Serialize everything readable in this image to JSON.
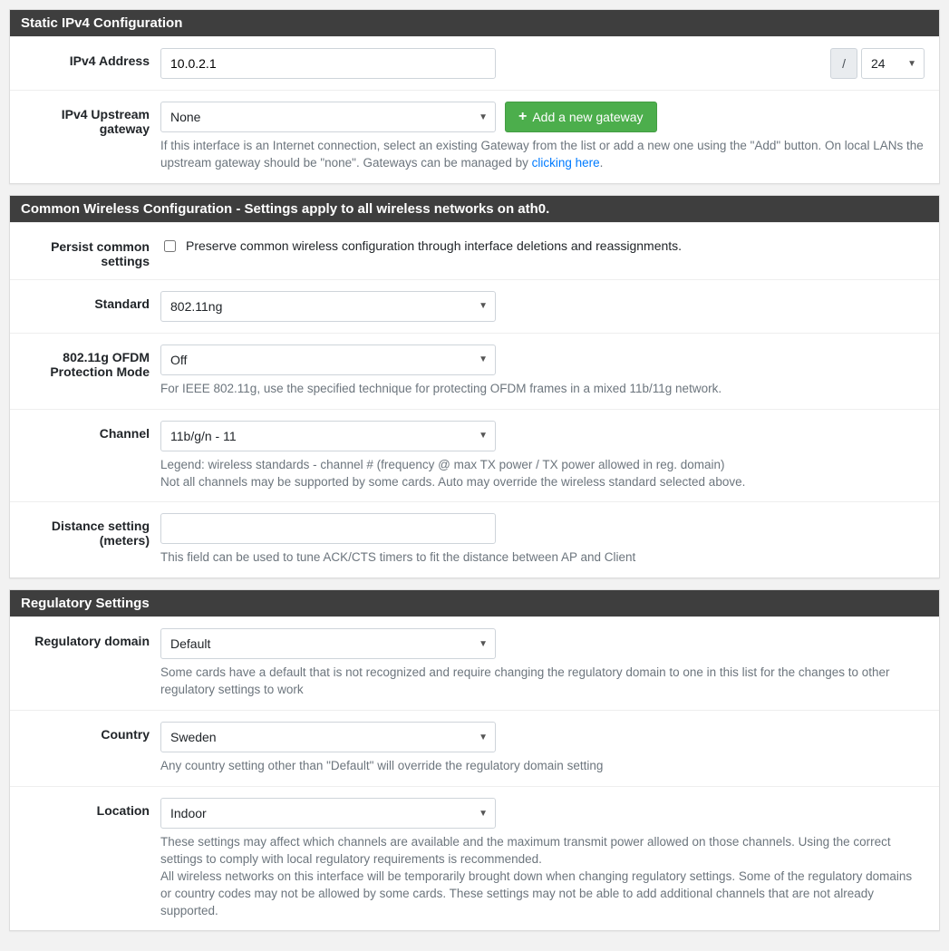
{
  "static_ipv4": {
    "title": "Static IPv4 Configuration",
    "address_label": "IPv4 Address",
    "address_value": "10.0.2.1",
    "slash": "/",
    "cidr": "24",
    "gateway_label": "IPv4 Upstream gateway",
    "gateway_value": "None",
    "add_gateway_btn": "Add a new gateway",
    "gateway_help_1": "If this interface is an Internet connection, select an existing Gateway from the list or add a new one using the \"Add\" button. On local LANs the upstream gateway should be \"none\". Gateways can be managed by ",
    "gateway_help_link": "clicking here",
    "gateway_help_2": "."
  },
  "common_wireless": {
    "title": "Common Wireless Configuration - Settings apply to all wireless networks on ath0.",
    "persist_label": "Persist common settings",
    "persist_check_text": "Preserve common wireless configuration through interface deletions and reassignments.",
    "standard_label": "Standard",
    "standard_value": "802.11ng",
    "protection_label": "802.11g OFDM Protection Mode",
    "protection_value": "Off",
    "protection_help": "For IEEE 802.11g, use the specified technique for protecting OFDM frames in a mixed 11b/11g network.",
    "channel_label": "Channel",
    "channel_value": "11b/g/n - 11",
    "channel_help_1": "Legend: wireless standards - channel # (frequency @ max TX power / TX power allowed in reg. domain)",
    "channel_help_2": "Not all channels may be supported by some cards. Auto may override the wireless standard selected above.",
    "distance_label": "Distance setting (meters)",
    "distance_value": "",
    "distance_help": "This field can be used to tune ACK/CTS timers to fit the distance between AP and Client"
  },
  "regulatory": {
    "title": "Regulatory Settings",
    "domain_label": "Regulatory domain",
    "domain_value": "Default",
    "domain_help": "Some cards have a default that is not recognized and require changing the regulatory domain to one in this list for the changes to other regulatory settings to work",
    "country_label": "Country",
    "country_value": "Sweden",
    "country_help": "Any country setting other than \"Default\" will override the regulatory domain setting",
    "location_label": "Location",
    "location_value": "Indoor",
    "location_help_1": "These settings may affect which channels are available and the maximum transmit power allowed on those channels. Using the correct settings to comply with local regulatory requirements is recommended.",
    "location_help_2": "All wireless networks on this interface will be temporarily brought down when changing regulatory settings. Some of the regulatory domains or country codes may not be allowed by some cards. These settings may not be able to add additional channels that are not already supported."
  }
}
